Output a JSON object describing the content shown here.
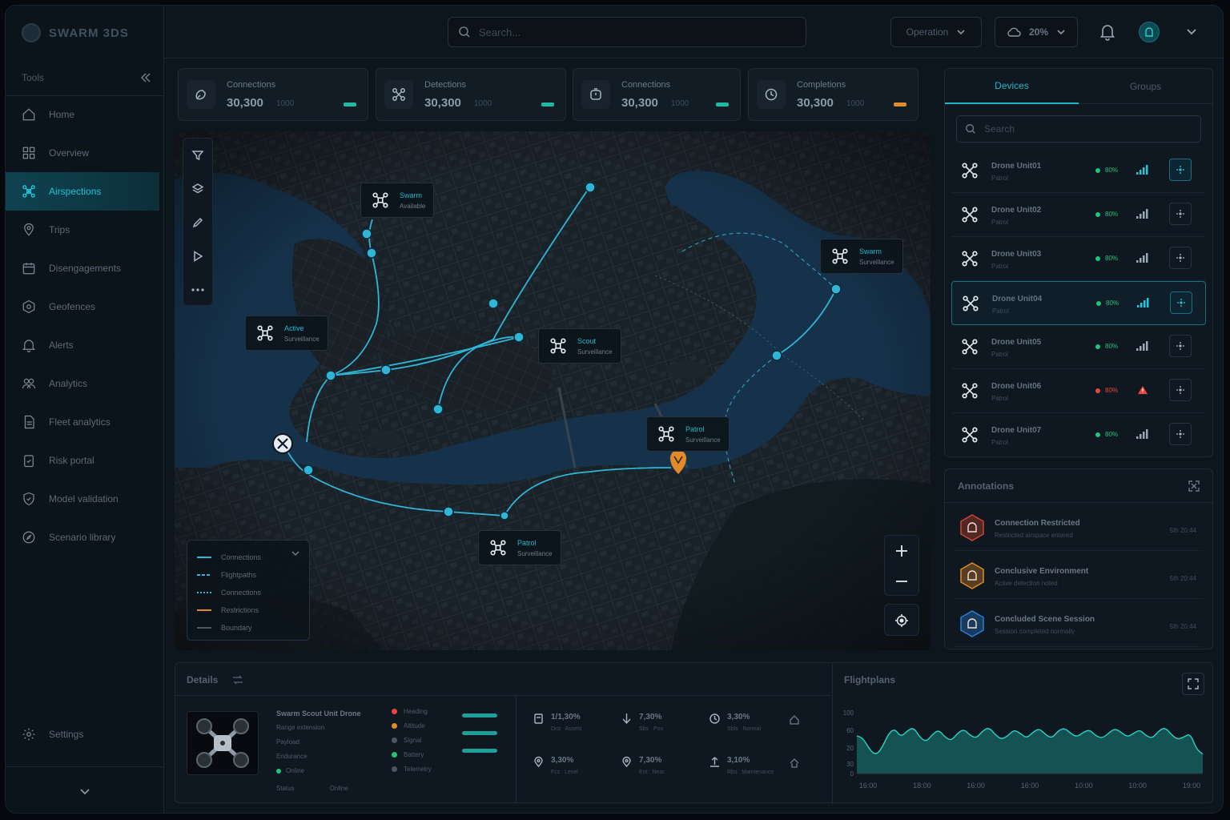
{
  "app": {
    "name": "SWARM 3DS"
  },
  "sidebar": {
    "section_label": "Tools",
    "items": [
      {
        "label": "Home",
        "icon": "home-icon"
      },
      {
        "label": "Overview",
        "icon": "grid-icon"
      },
      {
        "label": "Airspections",
        "icon": "drone-icon",
        "active": true
      },
      {
        "label": "Trips",
        "icon": "map-pin-icon"
      },
      {
        "label": "Disengagements",
        "icon": "calendar-icon"
      },
      {
        "label": "Geofences",
        "icon": "hexagon-icon"
      },
      {
        "label": "Alerts",
        "icon": "bell-icon"
      },
      {
        "label": "Analytics",
        "icon": "users-icon"
      },
      {
        "label": "Fleet analytics",
        "icon": "document-icon"
      },
      {
        "label": "Risk portal",
        "icon": "clipboard-check-icon"
      },
      {
        "label": "Model validation",
        "icon": "shield-icon"
      },
      {
        "label": "Scenario library",
        "icon": "compass-icon"
      }
    ],
    "settings_label": "Settings"
  },
  "topbar": {
    "search_placeholder": "Search...",
    "operation_select": "Operation",
    "weather_value": "20%"
  },
  "stats": [
    {
      "label": "Connections",
      "value": "30,300",
      "sub": "1000",
      "accent": "#1fb8a0"
    },
    {
      "label": "Detections",
      "value": "30,300",
      "sub": "1000",
      "accent": "#1fb8a0"
    },
    {
      "label": "Connections",
      "value": "30,300",
      "sub": "1000",
      "accent": "#1fb8a0"
    },
    {
      "label": "Completions",
      "value": "30,300",
      "sub": "1000",
      "accent": "#e08a2a"
    }
  ],
  "map": {
    "drone_cards": [
      {
        "name": "Swarm",
        "status": "Available"
      },
      {
        "name": "Active",
        "status": "Surveillance"
      },
      {
        "name": "Scout",
        "status": "Surveillance"
      },
      {
        "name": "Swarm",
        "status": "Surveillance"
      },
      {
        "name": "Patrol",
        "status": "Surveillance"
      },
      {
        "name": "Patrol",
        "status": "Surveillance"
      }
    ],
    "legend": [
      {
        "label": "Connections",
        "color": "#2fb6d6",
        "style": "solid"
      },
      {
        "label": "Flightpaths",
        "color": "#2fb6d6",
        "style": "dashed"
      },
      {
        "label": "Connections",
        "color": "#2fb6d6",
        "style": "dotted"
      },
      {
        "label": "Restrictions",
        "color": "#e08a2a",
        "style": "solid"
      },
      {
        "label": "Boundary",
        "color": "#4a5864",
        "style": "solid"
      }
    ]
  },
  "drone_panel": {
    "tabs": [
      "Devices",
      "Groups"
    ],
    "search_placeholder": "Search",
    "rows": [
      {
        "name": "Drone Unit01",
        "sub": "Patrol",
        "battery": "80%",
        "status_color": "#1fc47a",
        "selected": false,
        "warning": false
      },
      {
        "name": "Drone Unit02",
        "sub": "Patrol",
        "battery": "80%",
        "status_color": "#1fc47a",
        "selected": false,
        "warning": false
      },
      {
        "name": "Drone Unit03",
        "sub": "Patrol",
        "battery": "80%",
        "status_color": "#1fc47a",
        "selected": false,
        "warning": false
      },
      {
        "name": "Drone Unit04",
        "sub": "Patrol",
        "battery": "80%",
        "status_color": "#1fc47a",
        "selected": true,
        "warning": false
      },
      {
        "name": "Drone Unit05",
        "sub": "Patrol",
        "battery": "80%",
        "status_color": "#1fc47a",
        "selected": false,
        "warning": false
      },
      {
        "name": "Drone Unit06",
        "sub": "Patrol",
        "battery": "80%",
        "status_color": "#e8473b",
        "selected": false,
        "warning": true
      },
      {
        "name": "Drone Unit07",
        "sub": "Patrol",
        "battery": "80%",
        "status_color": "#1fc47a",
        "selected": false,
        "warning": false
      }
    ]
  },
  "alerts": {
    "title": "Annotations",
    "items": [
      {
        "title": "Connection Restricted",
        "sub": "Restricted airspace entered",
        "time": "5th 20:44",
        "color": "#d2452e"
      },
      {
        "title": "Conclusive Environment",
        "sub": "Active detection noted",
        "time": "5th 20:44",
        "color": "#e08a2a"
      },
      {
        "title": "Concluded Scene Session",
        "sub": "Session completed normally",
        "time": "5th 20:44",
        "color": "#2a7fd6"
      }
    ]
  },
  "details": {
    "title": "Details",
    "drone_name": "Swarm Scout Unit Drone",
    "specs": [
      "Range extension",
      "Payload",
      "Endurance"
    ],
    "spec_status": "Online",
    "footer_labels": [
      "Status",
      "Online"
    ],
    "status_items": [
      {
        "label": "Heading",
        "color": "#e8473b"
      },
      {
        "label": "Altitude",
        "color": "#e08a2a"
      },
      {
        "label": "Signal",
        "color": "#4a5864"
      },
      {
        "label": "Battery",
        "color": "#1fc47a"
      },
      {
        "label": "Telemetry",
        "color": "#4a5864"
      }
    ],
    "metrics": [
      {
        "value": "1/1,30%",
        "label": "Dist",
        "sub": "Assets"
      },
      {
        "value": "7,30%",
        "label": "Sbs",
        "sub": "Pos"
      },
      {
        "value": "3,30%",
        "label": "Sbls",
        "sub": "Normal"
      },
      {
        "value": "3,30%",
        "label": "Fcs",
        "sub": "Level"
      },
      {
        "value": "7,30%",
        "label": "Ent",
        "sub": "Near"
      },
      {
        "value": "3,10%",
        "label": "Rbs",
        "sub": "Maintenance"
      }
    ]
  },
  "chart_data": {
    "type": "area",
    "title": "Flightplans",
    "x_ticks": [
      "16:00",
      "18:00",
      "16:00",
      "16:00",
      "10:00",
      "10:00",
      "19:00"
    ],
    "y_ticks": [
      100,
      60,
      20,
      30,
      0
    ],
    "ylim": [
      0,
      100
    ],
    "series": [
      {
        "values": [
          62,
          58,
          40,
          30,
          42,
          65,
          74,
          60,
          70,
          76,
          60,
          52,
          64,
          72,
          60,
          54,
          66,
          73,
          63,
          58,
          70,
          76,
          64,
          56,
          62,
          72,
          66,
          58,
          68,
          74,
          64,
          58,
          70,
          75,
          66,
          60,
          68,
          72,
          62,
          58,
          66,
          74,
          68,
          60,
          66,
          72,
          62,
          58,
          70,
          76,
          64,
          56,
          60,
          66,
          40,
          32
        ]
      }
    ],
    "color": "#1a9c8f"
  }
}
